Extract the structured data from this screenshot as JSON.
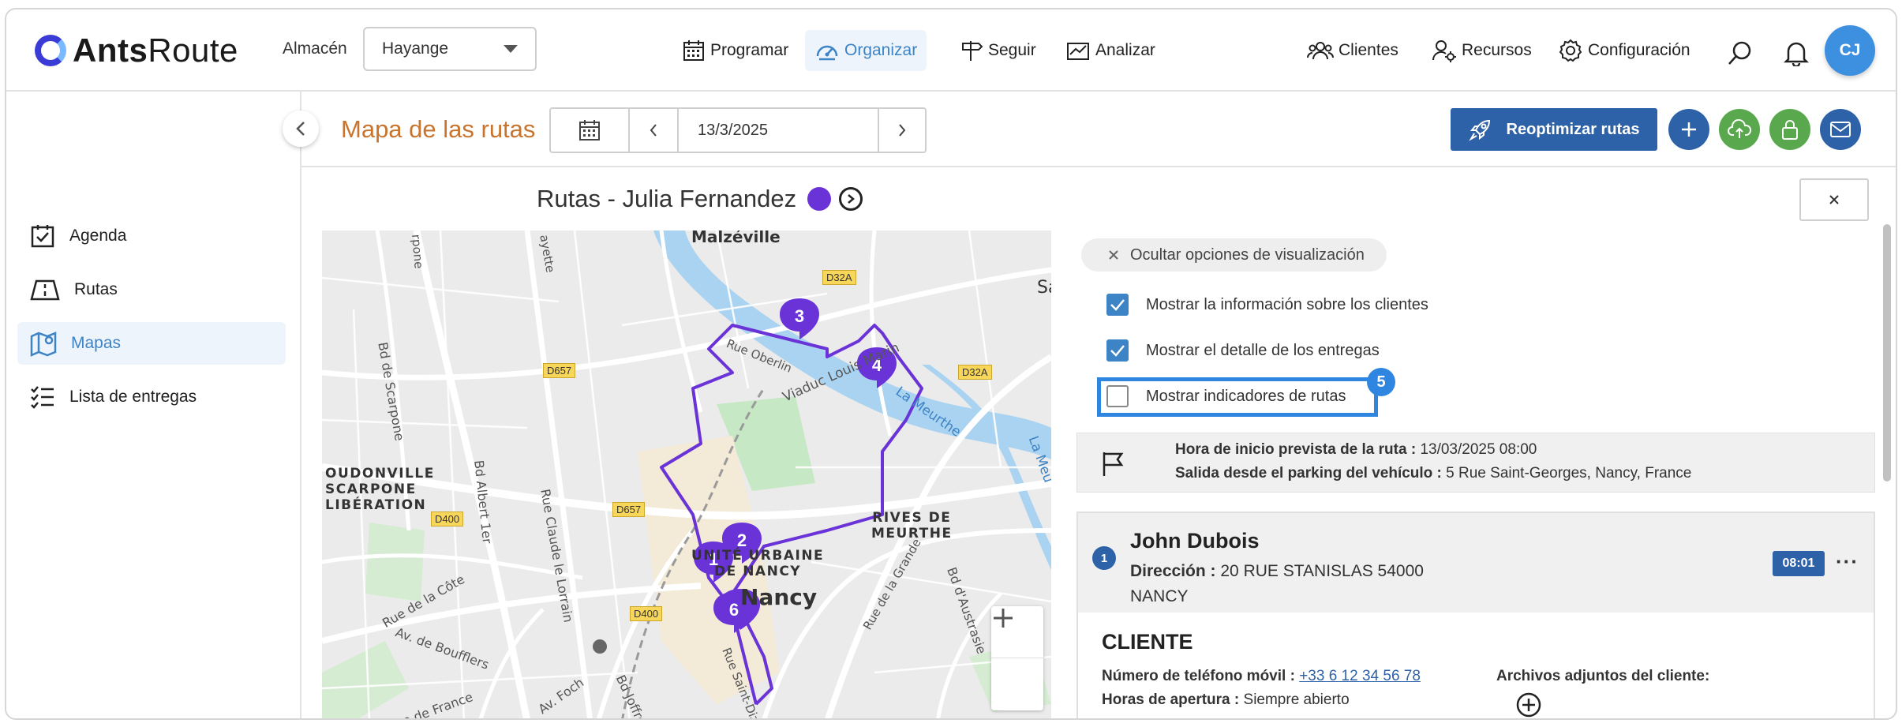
{
  "app": {
    "logo_bold": "Ants",
    "logo_regular": "Route"
  },
  "header": {
    "store_label": "Almacén",
    "store_value": "Hayange",
    "nav": [
      {
        "label": "Programar",
        "icon": "calendar-icon"
      },
      {
        "label": "Organizar",
        "icon": "dashboard-icon",
        "active": true
      },
      {
        "label": "Seguir",
        "icon": "signpost-icon"
      },
      {
        "label": "Analizar",
        "icon": "chart-icon"
      }
    ],
    "right_nav": [
      {
        "label": "Clientes",
        "icon": "users-icon"
      },
      {
        "label": "Recursos",
        "icon": "resources-icon"
      },
      {
        "label": "Configuración",
        "icon": "gear-icon"
      }
    ],
    "avatar_initials": "CJ"
  },
  "sidebar": {
    "items": [
      {
        "label": "Agenda",
        "icon": "calendar-check-icon"
      },
      {
        "label": "Rutas",
        "icon": "route-icon"
      },
      {
        "label": "Mapas",
        "icon": "map-icon",
        "active": true
      },
      {
        "label": "Lista de entregas",
        "icon": "list-icon"
      }
    ]
  },
  "subheader": {
    "page_title": "Mapa de las rutas",
    "date": "13/3/2025",
    "reoptimize_label": "Reoptimizar rutas",
    "accent_color": "#2e62a8"
  },
  "route": {
    "title": "Rutas - Julia Fernandez",
    "color": "#6a33d8"
  },
  "map": {
    "markers": [
      "1",
      "2",
      "3",
      "4",
      "6"
    ],
    "labels": {
      "malzeville": "Malzéville",
      "sa": "Sa",
      "rue_oberlin": "Rue Oberlin",
      "viaduc": "Viaduc Louis Marin",
      "meurthe": "La Meurthe",
      "la_meu": "La Meu",
      "bd_scarpone": "Bd de Scarpone",
      "rpone": "rpone",
      "ayette": "ayette",
      "d657a": "D657",
      "d657b": "D657",
      "d32a_top": "D32A",
      "d32a_right": "D32A",
      "d400a": "D400",
      "d400b": "D400",
      "scarpone_district": "OUDONVILLE\nSCARPONE\nLIBÉRATION",
      "bd_albert": "Bd Albert 1er",
      "rue_claude": "Rue Claude le Lorrain",
      "rives": "RIVES DE\nMEURTHE",
      "unite": "UNITÉ URBAINE\nDE NANCY",
      "nancy": "Nancy",
      "rue_cote": "Rue de la Côte",
      "bouffiers": "Av. de Boufflers",
      "france": "Rue de France",
      "foch": "Av. Foch",
      "joffre": "Bd Joffre",
      "austrasie": "Bd d'Austrasie",
      "saint_dizier": "Rue Saint-Dizier",
      "grande": "Rue de la Grande"
    }
  },
  "panel": {
    "hide_options_label": "Ocultar opciones de visualización",
    "options": [
      {
        "label": "Mostrar la información sobre los clientes",
        "checked": true
      },
      {
        "label": "Mostrar el detalle de los entregas",
        "checked": true
      },
      {
        "label": "Mostrar indicadores de rutas",
        "checked": false
      }
    ],
    "highlight_badge": "5",
    "start": {
      "time_label": "Hora de inicio prevista de la ruta :",
      "time_value": "13/03/2025 08:00",
      "parking_label": "Salida desde el parking del vehículo :",
      "parking_value": "5 Rue Saint-Georges, Nancy, France"
    },
    "client": {
      "number": "1",
      "name": "John Dubois",
      "address_label": "Dirección :",
      "address_value": "20 RUE STANISLAS 54000 NANCY",
      "time": "08:01",
      "more": "···",
      "section_title": "CLIENTE",
      "phone_label": "Número de teléfono móvil :",
      "phone_value": "+33 6 12 34 56 78",
      "hours_label": "Horas de apertura :",
      "hours_value": "Siempre abierto",
      "attachments_label": "Archivos adjuntos del cliente:"
    }
  }
}
